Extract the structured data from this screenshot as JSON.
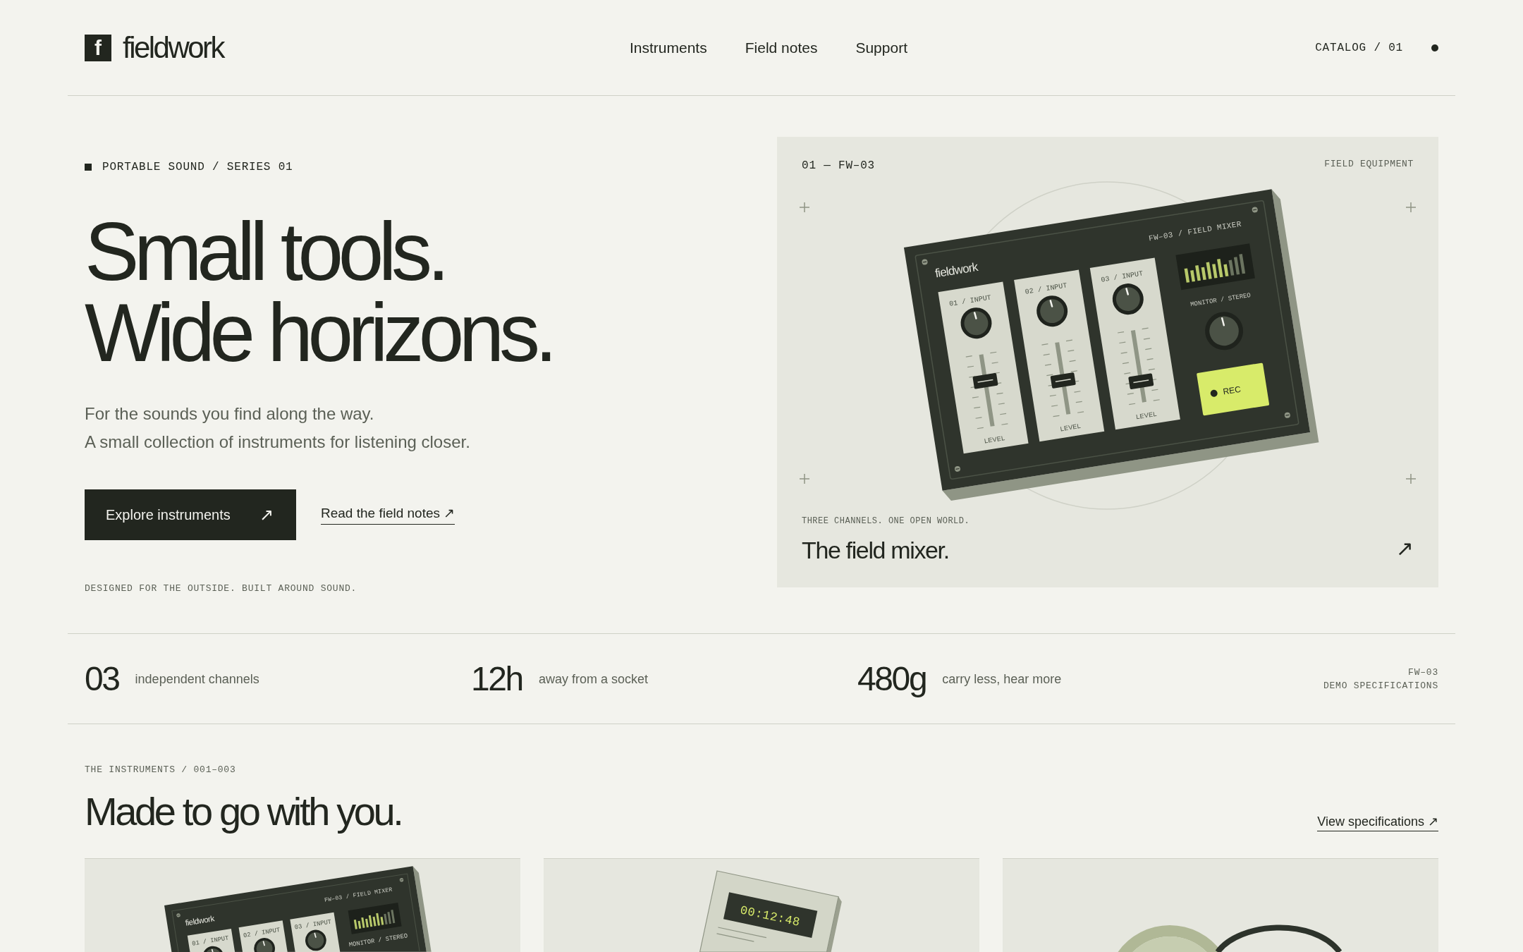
{
  "header": {
    "logo_mark": "f",
    "logo_text": "fieldwork",
    "nav": [
      "Instruments",
      "Field notes",
      "Support"
    ],
    "catalog": "CATALOG / 01"
  },
  "hero": {
    "eyebrow": "PORTABLE SOUND / SERIES 01",
    "headline": "Small tools. Wide horizons.",
    "intro": [
      "For the sounds you find along the way.",
      "A small collection of instruments for listening closer."
    ],
    "primary_button": {
      "label": "Explore instruments",
      "arrow": "↗"
    },
    "secondary_link": "Read the field notes ↗",
    "tagline": "DESIGNED FOR THE OUTSIDE. BUILT AROUND SOUND.",
    "feature_card": {
      "index": "01 — FW–03",
      "category": "FIELD EQUIPMENT",
      "mixer": {
        "brand": "fieldwork",
        "model": "FW–03 / FIELD MIXER",
        "channels": [
          {
            "label": "01 / INPUT",
            "level": 0.63,
            "level_label": "LEVEL"
          },
          {
            "label": "02 / INPUT",
            "level": 0.47,
            "level_label": "LEVEL"
          },
          {
            "label": "03 / INPUT",
            "level": 0.29,
            "level_label": "LEVEL"
          }
        ],
        "monitor_label": "MONITOR / STEREO",
        "rec_label": "REC"
      },
      "caption": "THREE CHANNELS. ONE OPEN WORLD.",
      "title": "The field mixer.",
      "arrow": "↗"
    }
  },
  "stats": {
    "items": [
      {
        "value": "03",
        "label": "independent channels"
      },
      {
        "value": "12h",
        "label": "away from a socket"
      },
      {
        "value": "480g",
        "label": "carry less, hear more"
      }
    ],
    "note": [
      "FW–03",
      "DEMO SPECIFICATIONS"
    ]
  },
  "instruments": {
    "eyebrow": "THE INSTRUMENTS / 001–003",
    "heading": "Made to go with you.",
    "link": "View specifications ↗",
    "cards": [
      {
        "kind": "mixer",
        "mixer": {
          "brand": "fieldwork",
          "model": "FW–03 / FIELD MIXER",
          "channels": [
            {
              "label": "01 / INPUT"
            },
            {
              "label": "02 / INPUT"
            },
            {
              "label": "03 / INPUT"
            }
          ],
          "monitor_label": "MONITOR / STEREO"
        }
      },
      {
        "kind": "timer",
        "readout": "00:12:48"
      },
      {
        "kind": "headphones"
      }
    ]
  }
}
